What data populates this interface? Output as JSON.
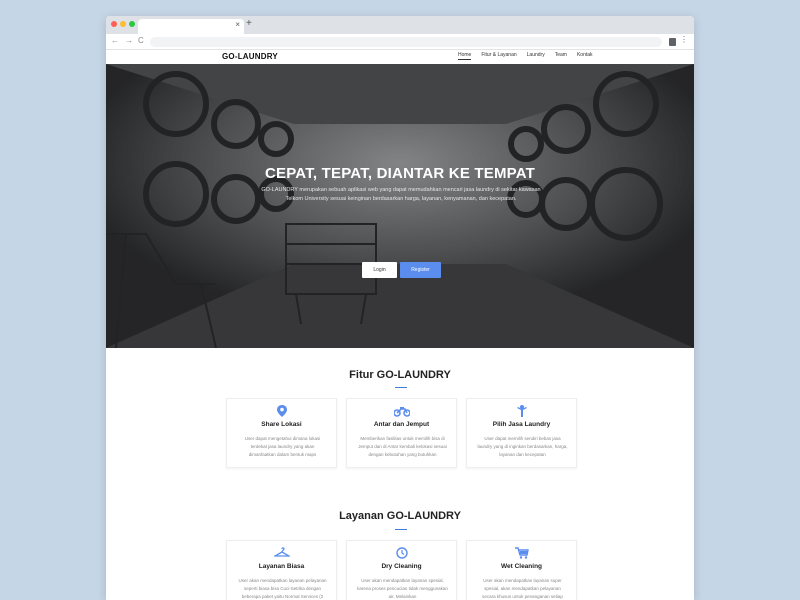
{
  "browser": {
    "tab_close": "×",
    "new_tab": "+",
    "back": "←",
    "forward": "→",
    "reload": "C",
    "menu": "⋮"
  },
  "site": {
    "brand": "GO-LAUNDRY",
    "menu": [
      "Home",
      "Fitur & Layanan",
      "Laundry",
      "Team",
      "Kontak"
    ]
  },
  "hero": {
    "title": "CEPAT, TEPAT, DIANTAR KE TEMPAT",
    "description": "GO-LAUNDRY merupakan sebuah aplikasi web yang dapat memudahkan mencari jasa laundry di sekitar kawasan Telkom University sesuai keinginan berdasarkan harga, layanan, kenyamanan, dan kecepatan.",
    "login_label": "Login",
    "register_label": "Register"
  },
  "features": {
    "title": "Fitur GO-LAUNDRY",
    "cards": [
      {
        "icon": "location-pin-icon",
        "title": "Share Lokasi",
        "desc": "User dapat mengetahui dimana lokasi terdekat jasa laundry yang akan dimanfaatkan dalam bentuk maps"
      },
      {
        "icon": "motorcycle-icon",
        "title": "Antar dan Jemput",
        "desc": "Memberikan fasilitas untuk memilih bisa di Jemput dan di Antar kembali kelokasi sesuai dengan kebutuhan yang butuhkan"
      },
      {
        "icon": "person-icon",
        "title": "Pilih Jasa Laundry",
        "desc": "User dapat memilih sendiri bebas jasa laundry yang di inginkan berdasarkan, harga, layanan dan kecepatan"
      }
    ]
  },
  "services": {
    "title": "Layanan GO-LAUNDRY",
    "cards": [
      {
        "icon": "hanger-icon",
        "title": "Layanan Biasa",
        "desc": "User akan mendapatkan layanan pelayanan seperti biasa bisa Cuci-Setrika dengan beberapa paket yaitu Normal Services (2"
      },
      {
        "icon": "clock-icon",
        "title": "Dry Cleaning",
        "desc": "User akan mendapatkan layanan spesial, karena proses pencucian tidak menggunakan air. Melainkan"
      },
      {
        "icon": "cart-icon",
        "title": "Wet Cleaning",
        "desc": "User akan mendapatkan layanan super spesial, akan mendapatkan pelayanan secara khusus untuk penanganan setiap"
      }
    ]
  }
}
